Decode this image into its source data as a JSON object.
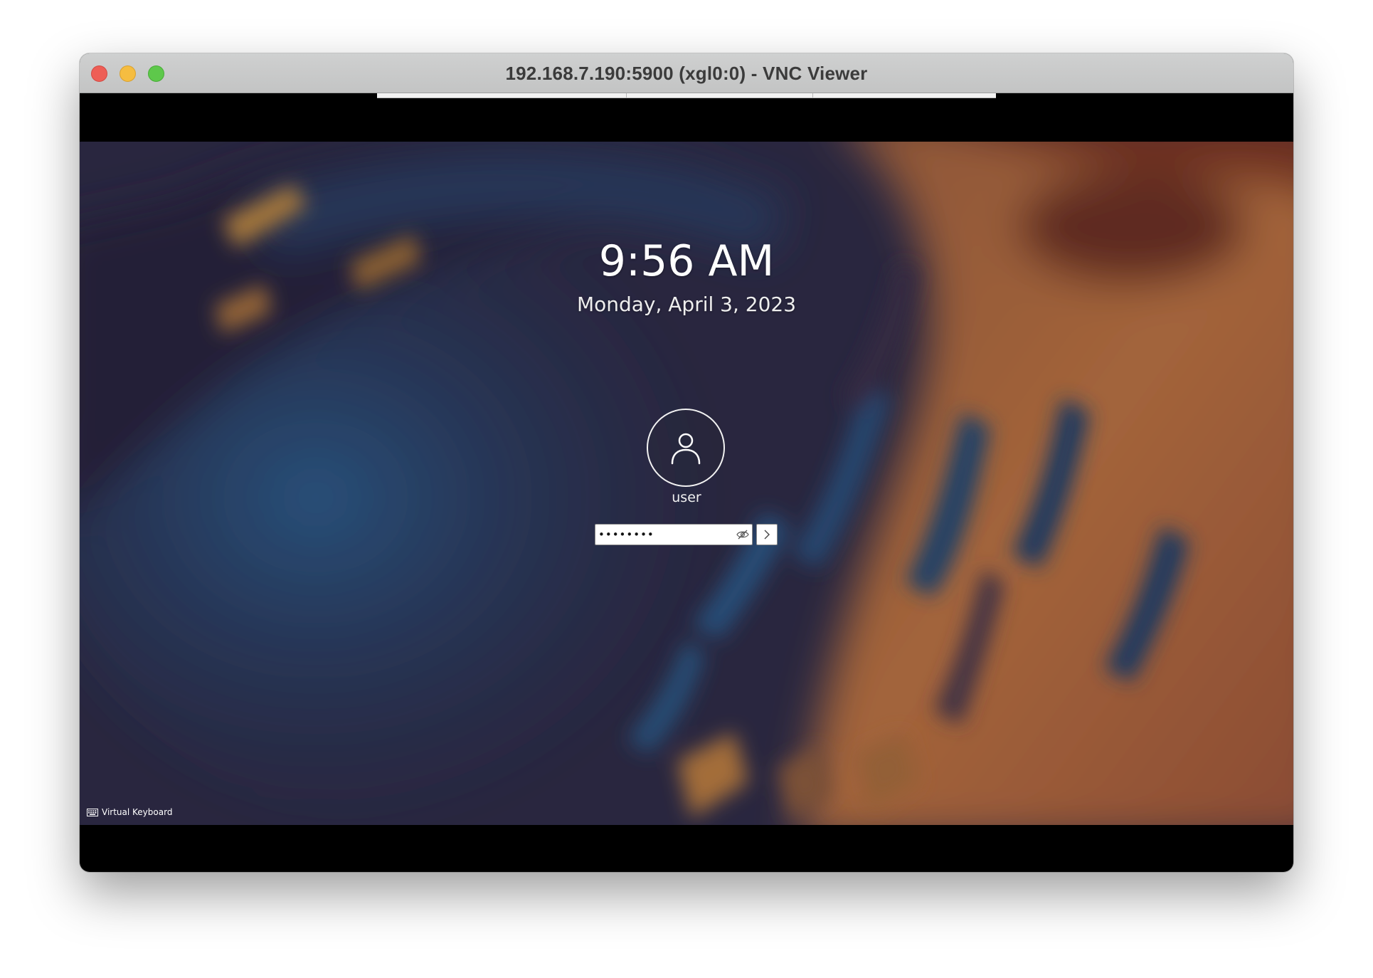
{
  "window": {
    "title": "192.168.7.190:5900 (xgl0:0) - VNC Viewer"
  },
  "lockscreen": {
    "time": "9:56 AM",
    "date": "Monday, April 3, 2023",
    "user": {
      "name": "user",
      "avatar_icon": "user-icon"
    },
    "password": {
      "value": "••••••••",
      "reveal_icon": "eye-slash-icon"
    },
    "login_icon": "chevron-right-icon",
    "virtual_keyboard_label": "Virtual Keyboard",
    "virtual_keyboard_icon": "keyboard-icon"
  },
  "colors": {
    "titlebar": "#c9caca",
    "close": "#ee5e56",
    "minimize": "#f5bd41",
    "maximize": "#5ec84b",
    "wallpaper_blue": "#284d78",
    "wallpaper_orange": "#b26a3c",
    "wallpaper_dark": "#2d2a44"
  }
}
